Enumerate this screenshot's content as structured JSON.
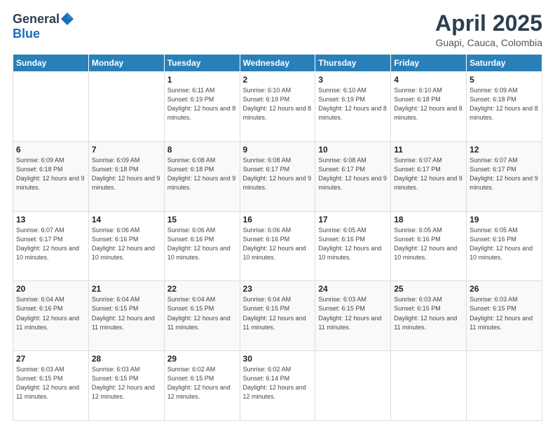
{
  "logo": {
    "general": "General",
    "blue": "Blue"
  },
  "header": {
    "title": "April 2025",
    "subtitle": "Guapi, Cauca, Colombia"
  },
  "days_of_week": [
    "Sunday",
    "Monday",
    "Tuesday",
    "Wednesday",
    "Thursday",
    "Friday",
    "Saturday"
  ],
  "weeks": [
    [
      {
        "day": "",
        "info": ""
      },
      {
        "day": "",
        "info": ""
      },
      {
        "day": "1",
        "info": "Sunrise: 6:11 AM\nSunset: 6:19 PM\nDaylight: 12 hours and 8 minutes."
      },
      {
        "day": "2",
        "info": "Sunrise: 6:10 AM\nSunset: 6:19 PM\nDaylight: 12 hours and 8 minutes."
      },
      {
        "day": "3",
        "info": "Sunrise: 6:10 AM\nSunset: 6:19 PM\nDaylight: 12 hours and 8 minutes."
      },
      {
        "day": "4",
        "info": "Sunrise: 6:10 AM\nSunset: 6:18 PM\nDaylight: 12 hours and 8 minutes."
      },
      {
        "day": "5",
        "info": "Sunrise: 6:09 AM\nSunset: 6:18 PM\nDaylight: 12 hours and 8 minutes."
      }
    ],
    [
      {
        "day": "6",
        "info": "Sunrise: 6:09 AM\nSunset: 6:18 PM\nDaylight: 12 hours and 9 minutes."
      },
      {
        "day": "7",
        "info": "Sunrise: 6:09 AM\nSunset: 6:18 PM\nDaylight: 12 hours and 9 minutes."
      },
      {
        "day": "8",
        "info": "Sunrise: 6:08 AM\nSunset: 6:18 PM\nDaylight: 12 hours and 9 minutes."
      },
      {
        "day": "9",
        "info": "Sunrise: 6:08 AM\nSunset: 6:17 PM\nDaylight: 12 hours and 9 minutes."
      },
      {
        "day": "10",
        "info": "Sunrise: 6:08 AM\nSunset: 6:17 PM\nDaylight: 12 hours and 9 minutes."
      },
      {
        "day": "11",
        "info": "Sunrise: 6:07 AM\nSunset: 6:17 PM\nDaylight: 12 hours and 9 minutes."
      },
      {
        "day": "12",
        "info": "Sunrise: 6:07 AM\nSunset: 6:17 PM\nDaylight: 12 hours and 9 minutes."
      }
    ],
    [
      {
        "day": "13",
        "info": "Sunrise: 6:07 AM\nSunset: 6:17 PM\nDaylight: 12 hours and 10 minutes."
      },
      {
        "day": "14",
        "info": "Sunrise: 6:06 AM\nSunset: 6:16 PM\nDaylight: 12 hours and 10 minutes."
      },
      {
        "day": "15",
        "info": "Sunrise: 6:06 AM\nSunset: 6:16 PM\nDaylight: 12 hours and 10 minutes."
      },
      {
        "day": "16",
        "info": "Sunrise: 6:06 AM\nSunset: 6:16 PM\nDaylight: 12 hours and 10 minutes."
      },
      {
        "day": "17",
        "info": "Sunrise: 6:05 AM\nSunset: 6:16 PM\nDaylight: 12 hours and 10 minutes."
      },
      {
        "day": "18",
        "info": "Sunrise: 6:05 AM\nSunset: 6:16 PM\nDaylight: 12 hours and 10 minutes."
      },
      {
        "day": "19",
        "info": "Sunrise: 6:05 AM\nSunset: 6:16 PM\nDaylight: 12 hours and 10 minutes."
      }
    ],
    [
      {
        "day": "20",
        "info": "Sunrise: 6:04 AM\nSunset: 6:16 PM\nDaylight: 12 hours and 11 minutes."
      },
      {
        "day": "21",
        "info": "Sunrise: 6:04 AM\nSunset: 6:15 PM\nDaylight: 12 hours and 11 minutes."
      },
      {
        "day": "22",
        "info": "Sunrise: 6:04 AM\nSunset: 6:15 PM\nDaylight: 12 hours and 11 minutes."
      },
      {
        "day": "23",
        "info": "Sunrise: 6:04 AM\nSunset: 6:15 PM\nDaylight: 12 hours and 11 minutes."
      },
      {
        "day": "24",
        "info": "Sunrise: 6:03 AM\nSunset: 6:15 PM\nDaylight: 12 hours and 11 minutes."
      },
      {
        "day": "25",
        "info": "Sunrise: 6:03 AM\nSunset: 6:15 PM\nDaylight: 12 hours and 11 minutes."
      },
      {
        "day": "26",
        "info": "Sunrise: 6:03 AM\nSunset: 6:15 PM\nDaylight: 12 hours and 11 minutes."
      }
    ],
    [
      {
        "day": "27",
        "info": "Sunrise: 6:03 AM\nSunset: 6:15 PM\nDaylight: 12 hours and 11 minutes."
      },
      {
        "day": "28",
        "info": "Sunrise: 6:03 AM\nSunset: 6:15 PM\nDaylight: 12 hours and 12 minutes."
      },
      {
        "day": "29",
        "info": "Sunrise: 6:02 AM\nSunset: 6:15 PM\nDaylight: 12 hours and 12 minutes."
      },
      {
        "day": "30",
        "info": "Sunrise: 6:02 AM\nSunset: 6:14 PM\nDaylight: 12 hours and 12 minutes."
      },
      {
        "day": "",
        "info": ""
      },
      {
        "day": "",
        "info": ""
      },
      {
        "day": "",
        "info": ""
      }
    ]
  ]
}
